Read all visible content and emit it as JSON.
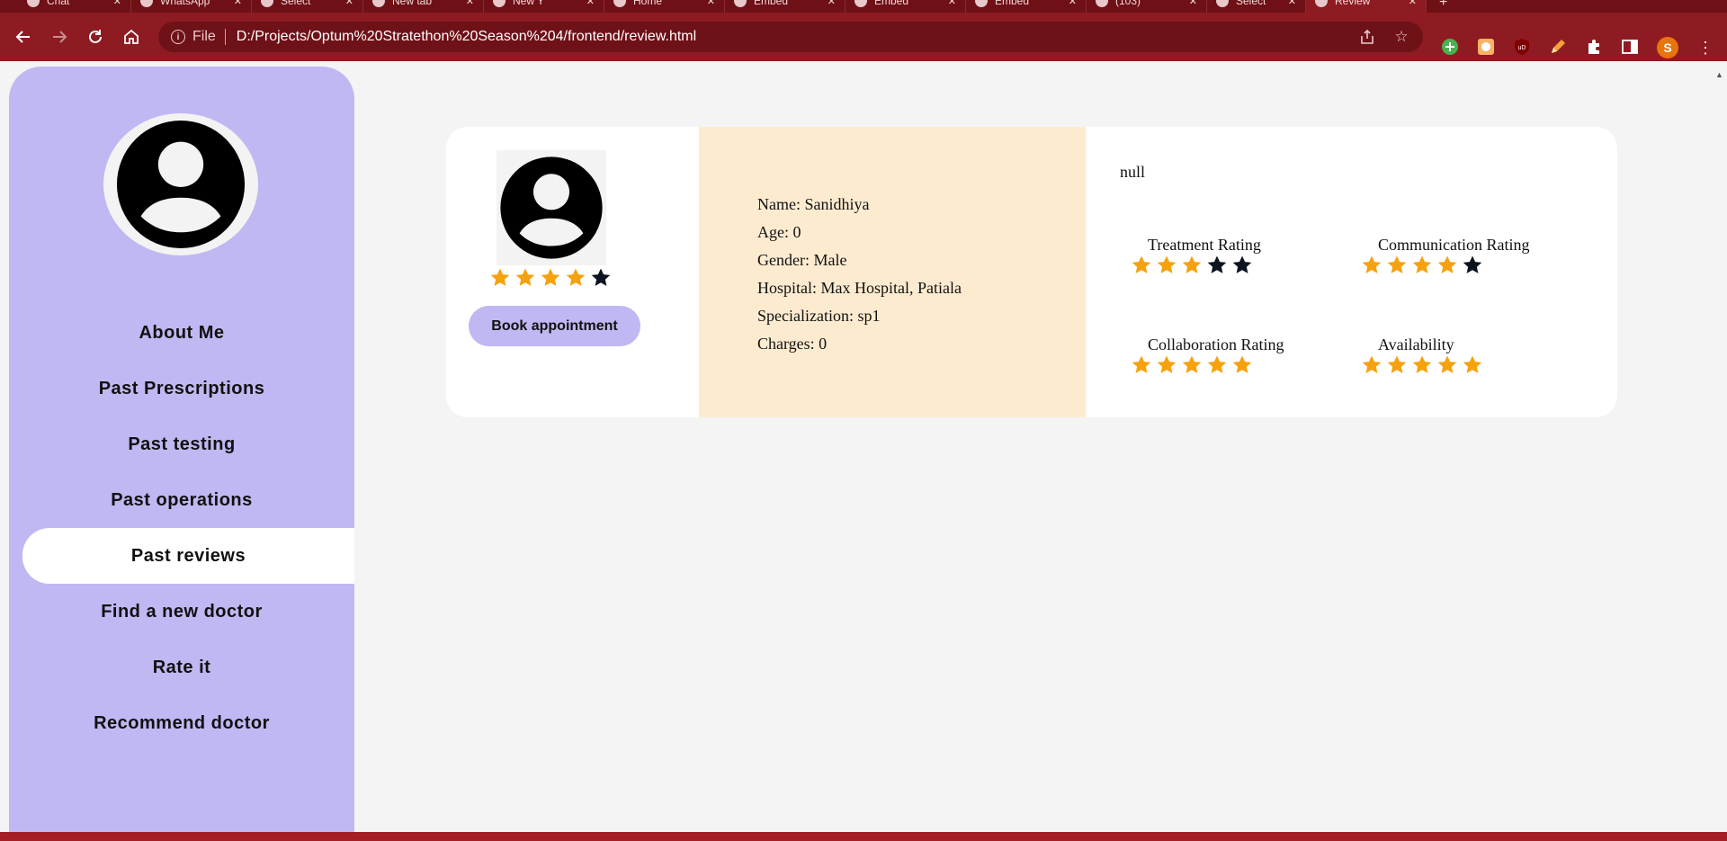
{
  "browser": {
    "tabs": [
      {
        "title": "Chat",
        "active": false
      },
      {
        "title": "WhatsApp",
        "active": false
      },
      {
        "title": "Select",
        "active": false
      },
      {
        "title": "New tab",
        "active": false
      },
      {
        "title": "New Y",
        "active": false
      },
      {
        "title": "Home",
        "active": false
      },
      {
        "title": "Embed",
        "active": false
      },
      {
        "title": "Embed",
        "active": false
      },
      {
        "title": "Embed",
        "active": false
      },
      {
        "title": "(103)",
        "active": false
      },
      {
        "title": "Select",
        "active": false
      },
      {
        "title": "Review",
        "active": true
      }
    ],
    "omnibox": {
      "chip_label": "File",
      "url": "D:/Projects/Optum%20Stratethon%20Season%204/frontend/review.html"
    },
    "profile_initial": "S"
  },
  "sidebar": {
    "items": [
      {
        "label": "About Me",
        "active": false
      },
      {
        "label": "Past Prescriptions",
        "active": false
      },
      {
        "label": "Past testing",
        "active": false
      },
      {
        "label": "Past operations",
        "active": false
      },
      {
        "label": "Past reviews",
        "active": true
      },
      {
        "label": "Find a new doctor",
        "active": false
      },
      {
        "label": "Rate it",
        "active": false
      },
      {
        "label": "Recommend doctor",
        "active": false
      }
    ]
  },
  "review": {
    "overall_rating": 4,
    "book_button_label": "Book appointment",
    "doctor": {
      "name": "Name: Sanidhiya",
      "age": "Age: 0",
      "gender": "Gender: Male",
      "hospital": "Hospital: Max Hospital, Patiala",
      "specialization": "Specialization: sp1",
      "charges": "Charges: 0"
    },
    "comment": "null",
    "ratings": {
      "treatment": {
        "label": "Treatment Rating",
        "value": 3
      },
      "communication": {
        "label": "Communication Rating",
        "value": 4
      },
      "collaboration": {
        "label": "Collaboration Rating",
        "value": 5
      },
      "availability": {
        "label": "Availability",
        "value": 5
      }
    },
    "star_max": 5,
    "star_filled_color": "#f5a20e",
    "star_empty_color": "#0c1420"
  }
}
